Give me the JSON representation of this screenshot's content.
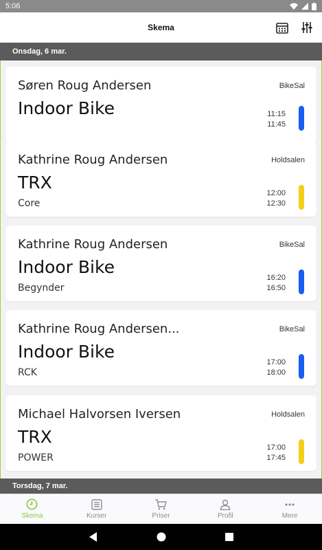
{
  "status": {
    "time": "5:06"
  },
  "header": {
    "title": "Skema",
    "calendar_icon": "calendar-icon",
    "filter_icon": "filter-sliders-icon"
  },
  "days": [
    {
      "label": "Onsdag, 6 mar.",
      "classes": [
        {
          "instructor": "Søren Roug Andersen",
          "room": "BikeSal",
          "name": "Indoor Bike",
          "sub": "",
          "start": "11:15",
          "end": "11:45",
          "color": "#1a5ef0"
        },
        {
          "instructor": "Kathrine Roug Andersen",
          "room": "Holdsalen",
          "name": "TRX",
          "sub": "Core",
          "start": "12:00",
          "end": "12:30",
          "color": "#f3cf17"
        },
        {
          "instructor": "Kathrine Roug Andersen",
          "room": "BikeSal",
          "name": "Indoor Bike",
          "sub": "Begynder",
          "start": "16:20",
          "end": "16:50",
          "color": "#1a5ef0"
        },
        {
          "instructor": "Kathrine Roug Andersen...",
          "room": "BikeSal",
          "name": "Indoor Bike",
          "sub": "RCK",
          "start": "17:00",
          "end": "18:00",
          "color": "#1a5ef0"
        },
        {
          "instructor": "Michael Halvorsen Iversen",
          "room": "Holdsalen",
          "name": "TRX",
          "sub": "POWER",
          "start": "17:00",
          "end": "17:45",
          "color": "#f3cf17"
        }
      ]
    },
    {
      "label": "Torsdag, 7 mar.",
      "classes": []
    }
  ],
  "tabs": [
    {
      "label": "Skema",
      "icon": "clock-icon",
      "active": true
    },
    {
      "label": "Kurser",
      "icon": "list-icon",
      "active": false
    },
    {
      "label": "Priser",
      "icon": "cart-icon",
      "active": false
    },
    {
      "label": "Profil",
      "icon": "person-icon",
      "active": false
    },
    {
      "label": "Mere",
      "icon": "more-dots-icon",
      "active": false
    }
  ],
  "colors": {
    "accent": "#8cc63f",
    "bike": "#1a5ef0",
    "trx": "#f3cf17",
    "day_header": "#5b5b5b"
  }
}
